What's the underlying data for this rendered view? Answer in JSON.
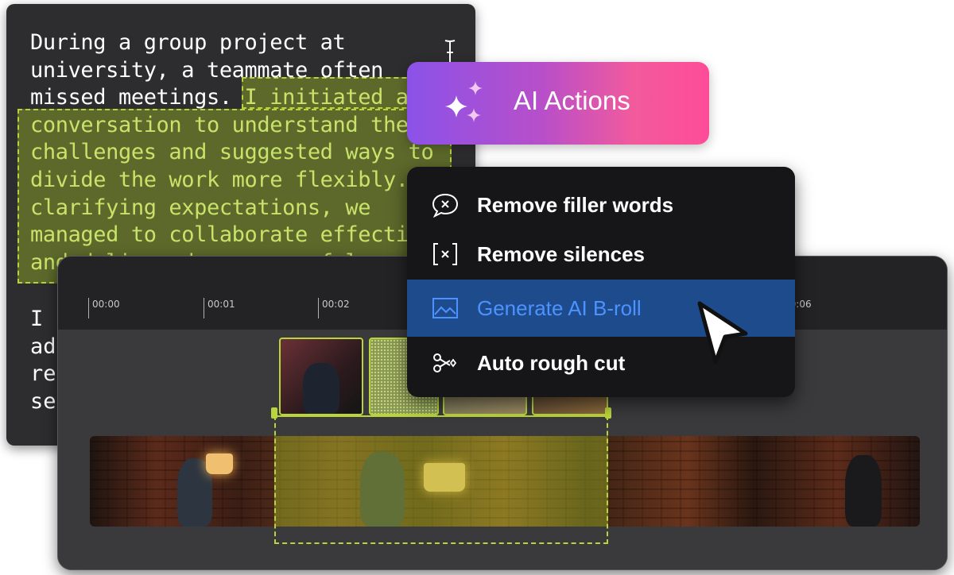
{
  "transcript": {
    "para1_plain": "During a group project at\nuniversity, a teammate often\nmissed meetings. ",
    "para1_selected": "I initiated a\nconversation to understand their\nchallenges and suggested ways to\ndivide the work more flexibly. By\nclarifying expectations, we\nmanaged to collaborate effectively\nand delivered a successful project.",
    "para2": "I b\nad\nres\nse"
  },
  "ai_button": {
    "label": "AI Actions",
    "icon": "sparkle-icon",
    "gradient_start": "#8b52e8",
    "gradient_end": "#ff4c98"
  },
  "menu": {
    "items": [
      {
        "label": "Remove filler words",
        "icon": "speech-bubble-x-icon",
        "active": false
      },
      {
        "label": "Remove silences",
        "icon": "bracket-x-icon",
        "active": false
      },
      {
        "label": "Generate AI B-roll",
        "icon": "image-icon",
        "active": true
      },
      {
        "label": "Auto rough cut",
        "icon": "scissors-icon",
        "active": false
      }
    ],
    "active_color": "#1e4b8c"
  },
  "timeline": {
    "ticks": [
      "00:00",
      "00:01",
      "00:02",
      "00:06"
    ],
    "accent": "#b9d43c"
  }
}
